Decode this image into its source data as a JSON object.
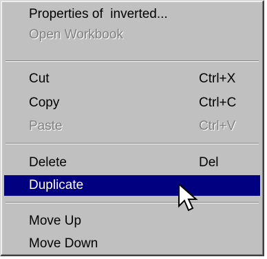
{
  "menu": {
    "items": [
      {
        "label": "Properties of  inverted...",
        "shortcut": "",
        "enabled": true
      },
      {
        "label": "Open Workbook",
        "shortcut": "",
        "enabled": false
      },
      {
        "label": "Cut",
        "shortcut": "Ctrl+X",
        "enabled": true
      },
      {
        "label": "Copy",
        "shortcut": "Ctrl+C",
        "enabled": true
      },
      {
        "label": "Paste",
        "shortcut": "Ctrl+V",
        "enabled": false
      },
      {
        "label": "Delete",
        "shortcut": "Del",
        "enabled": true
      },
      {
        "label": "Duplicate",
        "shortcut": "",
        "enabled": true,
        "highlighted": true
      },
      {
        "label": "Move Up",
        "shortcut": "",
        "enabled": true
      },
      {
        "label": "Move Down",
        "shortcut": "",
        "enabled": true
      }
    ]
  },
  "cursor": {
    "icon": "arrow-pointer-icon"
  },
  "colors": {
    "menu_background": "#c0c0c0",
    "highlight_background": "#000080",
    "highlight_text": "#ffffff",
    "disabled_text": "#808080"
  }
}
